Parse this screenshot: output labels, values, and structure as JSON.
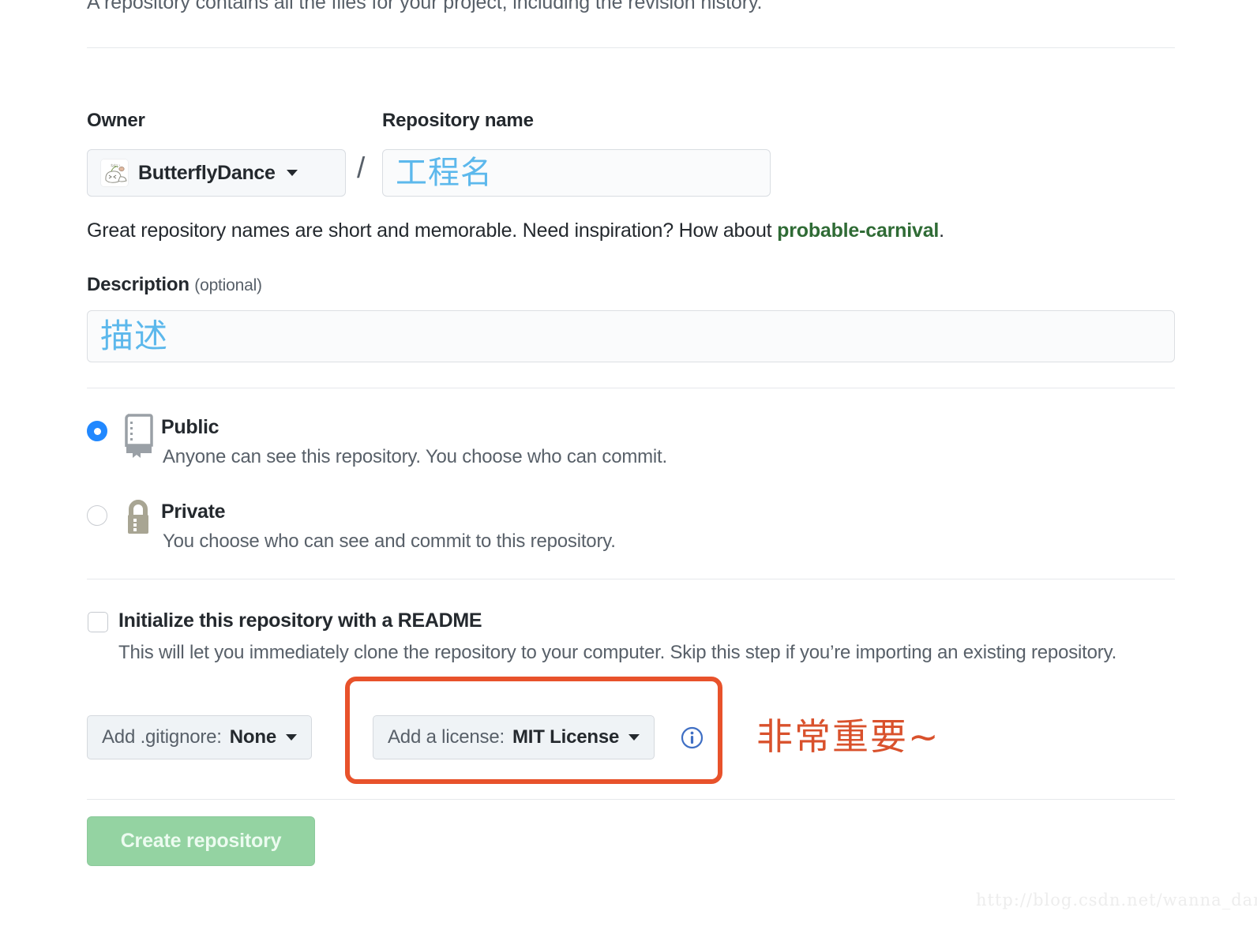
{
  "intro": {
    "text": "A repository contains all the files for your project, including the revision history."
  },
  "owner": {
    "label": "Owner",
    "name": "ButterflyDance",
    "avatar_icon": "cartoon-seal-avatar",
    "caret_icon": "caret-down-icon"
  },
  "separator": "/",
  "repo_name": {
    "label": "Repository name",
    "value": "",
    "annotation": "工程名"
  },
  "hint": {
    "prefix": "Great repository names are short and memorable. Need inspiration? How about ",
    "suggestion": "probable-carnival",
    "suffix": "."
  },
  "description": {
    "label": "Description",
    "optional": "(optional)",
    "value": "",
    "annotation": "描述"
  },
  "visibility": {
    "selected": "public",
    "options": [
      {
        "id": "public",
        "title": "Public",
        "subtitle": "Anyone can see this repository. You choose who can commit.",
        "icon": "repo-book-icon",
        "checked": true
      },
      {
        "id": "private",
        "title": "Private",
        "subtitle": "You choose who can see and commit to this repository.",
        "icon": "lock-icon",
        "checked": false
      }
    ]
  },
  "readme": {
    "title": "Initialize this repository with a README",
    "subtitle": "This will let you immediately clone the repository to your computer. Skip this step if you’re importing an existing repository.",
    "checked": false
  },
  "gitignore": {
    "prefix": "Add .gitignore:",
    "value": "None",
    "caret_icon": "caret-down-icon"
  },
  "license": {
    "prefix": "Add a license:",
    "value": "MIT License",
    "caret_icon": "caret-down-icon",
    "info_icon": "info-circle-icon"
  },
  "annotation": {
    "text": "非常重要~",
    "box_color": "#e8522b",
    "text_color": "#d9512c"
  },
  "submit": {
    "label": "Create repository",
    "disabled": true,
    "color": "#94d3a2"
  },
  "watermark": {
    "text": "http://blog.csdn.net/wanna_dance"
  },
  "colors": {
    "accent_blue": "#2188ff",
    "annotation_blue": "#5cb8ec",
    "green_link": "#2f6b35",
    "muted_text": "#586069",
    "lock_tan": "#a8a593"
  }
}
